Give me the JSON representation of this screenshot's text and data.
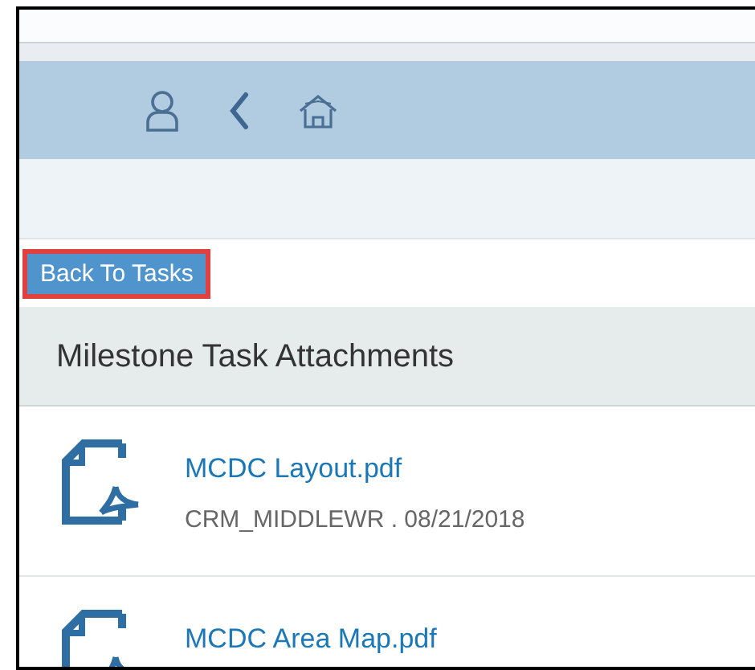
{
  "back_button": {
    "label": "Back To Tasks"
  },
  "section": {
    "title": "Milestone Task Attachments"
  },
  "attachments": [
    {
      "name": "MCDC Layout.pdf",
      "meta": "CRM_MIDDLEWR . 08/21/2018"
    },
    {
      "name": "MCDC Area Map.pdf"
    }
  ]
}
